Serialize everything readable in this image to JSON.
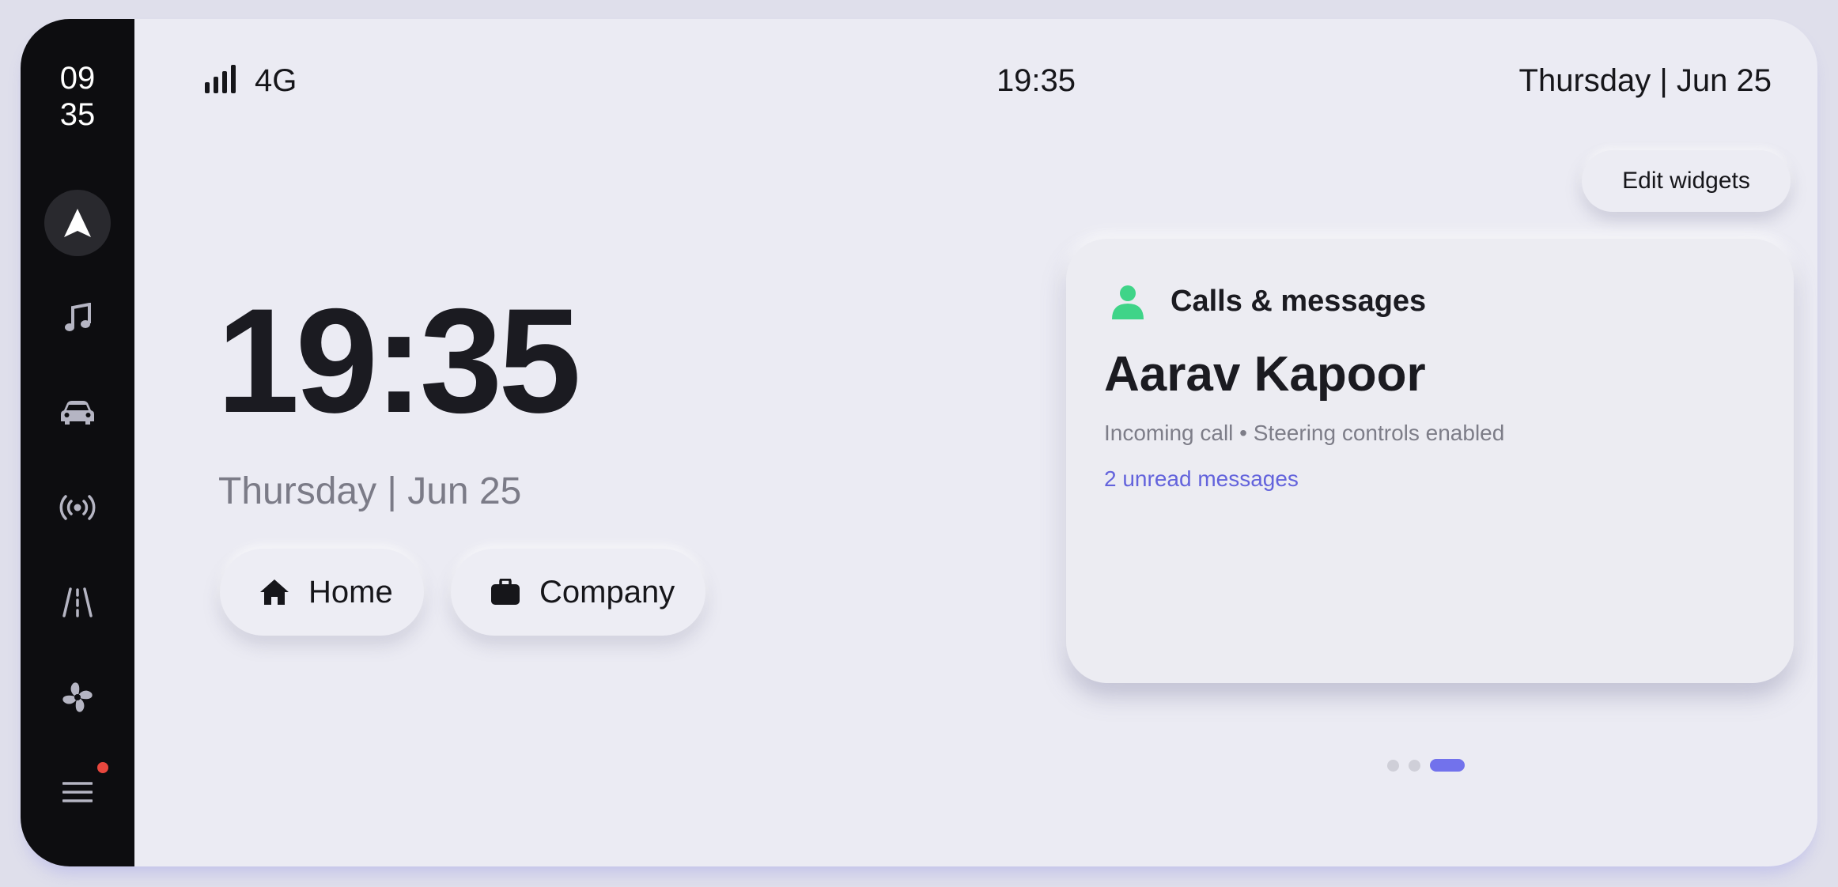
{
  "sidebar": {
    "clock_hours": "09",
    "clock_minutes": "35",
    "items": [
      {
        "name": "navigation",
        "icon": "navigation-arrow-icon",
        "active": true
      },
      {
        "name": "music",
        "icon": "music-note-icon",
        "active": false
      },
      {
        "name": "vehicle",
        "icon": "car-icon",
        "active": false
      },
      {
        "name": "radio",
        "icon": "broadcast-icon",
        "active": false
      },
      {
        "name": "driving",
        "icon": "road-icon",
        "active": false
      },
      {
        "name": "climate",
        "icon": "fan-icon",
        "active": false
      },
      {
        "name": "menu",
        "icon": "hamburger-menu-icon",
        "active": false,
        "has_notification": true
      }
    ]
  },
  "statusbar": {
    "network": "4G",
    "time": "19:35",
    "date": "Thursday | Jun 25"
  },
  "main": {
    "time": "19:35",
    "date": "Thursday | Jun 25",
    "shortcuts": [
      {
        "label": "Home",
        "icon": "home-icon"
      },
      {
        "label": "Company",
        "icon": "briefcase-icon"
      }
    ]
  },
  "edit_widgets_label": "Edit widgets",
  "widget": {
    "title": "Calls & messages",
    "icon": "person-icon",
    "contact_name": "Aarav Kapoor",
    "subtitle": "Incoming call • Steering controls enabled",
    "link": "2 unread messages"
  },
  "pager": {
    "count": 3,
    "active_index": 2
  },
  "colors": {
    "accent": "#7272ec",
    "link": "#6363dc",
    "contact_green": "#3fd488",
    "notification_red": "#e8473e",
    "sidebar_bg": "#0d0d10",
    "surface": "#ebebf3"
  }
}
